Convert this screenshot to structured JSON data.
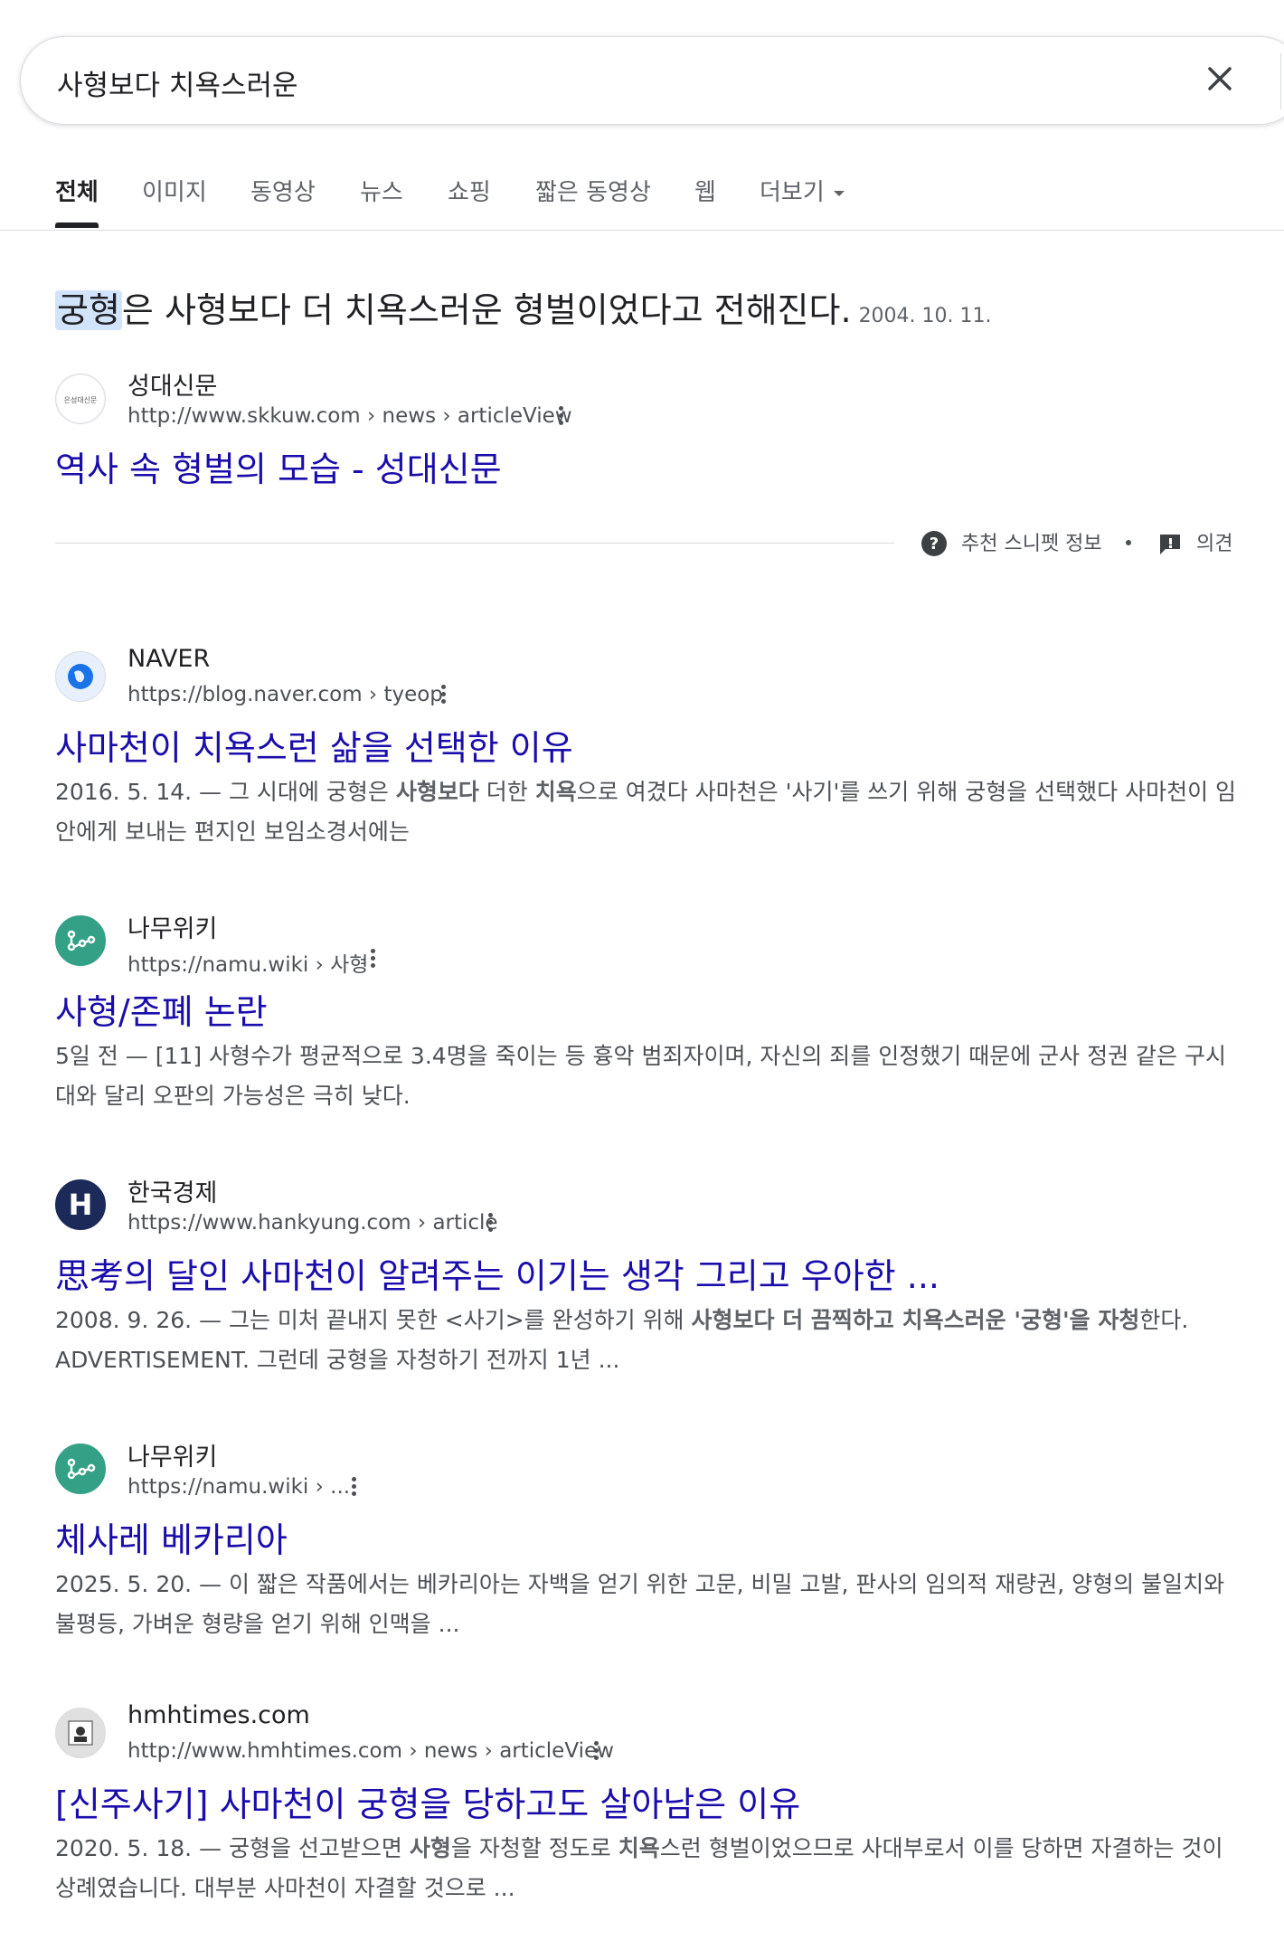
{
  "search": {
    "query": "사형보다 치욕스러운"
  },
  "tabs": [
    {
      "label": "전체"
    },
    {
      "label": "이미지"
    },
    {
      "label": "동영상"
    },
    {
      "label": "뉴스"
    },
    {
      "label": "쇼핑"
    },
    {
      "label": "짧은 동영상"
    },
    {
      "label": "웹"
    },
    {
      "label": "더보기"
    }
  ],
  "featured": {
    "highlight": "궁형",
    "answer_rest": "은 사형보다 더 치욕스러운 형벌이었다고 전해진다.",
    "date": "2004. 10. 11.",
    "site_name": "성대신문",
    "url": "http://www.skkuw.com › news › articleView",
    "title": "역사 속 형벌의 모습 - 성대신문",
    "favicon_text": "은성대신문",
    "footer_about": "추천 스니펫 정보",
    "footer_feedback": "의견"
  },
  "results": [
    {
      "site_name": "NAVER",
      "url": "https://blog.naver.com › tyeop",
      "title": "사마천이 치욕스런 삶을 선택한 이유",
      "date": "2016. 5. 14.",
      "desc_html": "그 시대에 궁형은 <b>사형보다</b> 더한 <b>치욕</b>으로 여겼다 사마천은 '사기'를 쓰기 위해 궁형을 선택했다 사마천이 임안에게 보내는 편지인 보임소경서에는"
    },
    {
      "site_name": "나무위키",
      "url": "https://namu.wiki › 사형",
      "title": "사형/존폐 논란",
      "date": "5일 전",
      "desc_html": "[11] 사형수가 평균적으로 3.4명을 죽이는 등 흉악 범죄자이며, 자신의 죄를 인정했기 때문에 군사 정권 같은 구시대와 달리 오판의 가능성은 극히 낮다."
    },
    {
      "site_name": "한국경제",
      "url": "https://www.hankyung.com › article",
      "title": "思考의 달인 사마천이 알려주는 이기는 생각 그리고 우아한 ...",
      "date": "2008. 9. 26.",
      "desc_html": "그는 미처 끝내지 못한 &lt;사기&gt;를 완성하기 위해 <b>사형보다 더 끔찍하고 치욕스러운 '궁형'을 자청</b>한다. ADVERTISEMENT. 그런데 궁형을 자청하기 전까지 1년 ..."
    },
    {
      "site_name": "나무위키",
      "url": "https://namu.wiki › ...",
      "title": "체사레 베카리아",
      "date": "2025. 5. 20.",
      "desc_html": "이 짧은 작품에서는 베카리아는 자백을 얻기 위한 고문, 비밀 고발, 판사의 임의적 재량권, 양형의 불일치와 불평등, 가벼운 형량을 얻기 위해 인맥을 ..."
    },
    {
      "site_name": "hmhtimes.com",
      "url": "http://www.hmhtimes.com › news › articleView",
      "title": "[신주사기] 사마천이 궁형을 당하고도 살아남은 이유",
      "date": "2020. 5. 18.",
      "desc_html": "궁형을 선고받으면 <b>사형</b>을 자청할 정도로 <b>치욕</b>스런 형벌이었으므로 사대부로서 이를 당하면 자결하는 것이 상례였습니다. 대부분 사마천이 자결할 것으로 ..."
    }
  ],
  "colors": {
    "link": "#1a0dab",
    "text": "#202124",
    "muted": "#4d5156",
    "highlight": "#d2e3fc"
  }
}
